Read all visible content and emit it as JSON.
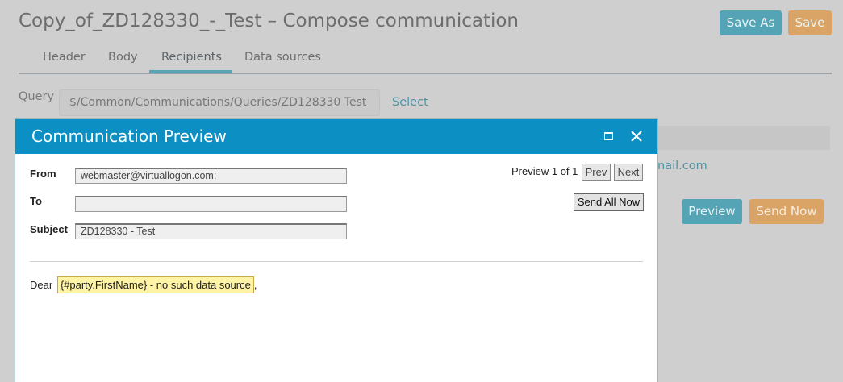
{
  "page": {
    "title": "Copy_of_ZD128330_-_Test – Compose communication",
    "save_as_label": "Save As",
    "save_label": "Save"
  },
  "tabs": [
    {
      "label": "Header"
    },
    {
      "label": "Body"
    },
    {
      "label": "Recipients"
    },
    {
      "label": "Data sources"
    }
  ],
  "query": {
    "label": "Query",
    "value": "$/Common/Communications/Queries/ZD128330 Test",
    "select_label": "Select"
  },
  "background": {
    "email_fragment": "nail.com",
    "preview_label": "Preview",
    "send_now_label": "Send Now"
  },
  "dialog": {
    "title": "Communication Preview",
    "from_label": "From",
    "from_value": "webmaster@virtuallogon.com;",
    "to_label": "To",
    "to_value": "",
    "subject_label": "Subject",
    "subject_value": "ZD128330 - Test",
    "preview_counter": "Preview 1 of 1",
    "prev_label": "Prev",
    "next_label": "Next",
    "send_all_label": "Send All Now",
    "body_greeting": "Dear",
    "body_placeholder": "{#party.FirstName} - no such data source",
    "body_trailing": ","
  },
  "colors": {
    "accent": "#0c8fc2",
    "teal_button": "#55a4b5",
    "orange_button": "#d9a466",
    "overlay_bg": "#cfcfcf"
  }
}
